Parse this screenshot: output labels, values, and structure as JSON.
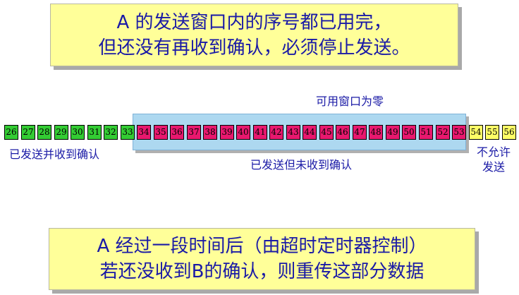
{
  "top_note": {
    "line1": "A 的发送窗口内的序号都已用完，",
    "line2": "但还没有再收到确认，必须停止发送。"
  },
  "bottom_note": {
    "line1": "A 经过一段时间后（由超时定时器控制）",
    "line2": "若还没收到B的确认，则重传这部分数据"
  },
  "labels": {
    "window": "可用窗口为零",
    "acked": "已发送并收到确认",
    "sent_unacked": "已发送但未收到确认",
    "not_allowed_1": "不允许",
    "not_allowed_2": "发送"
  },
  "segments": [
    {
      "state": "acked",
      "seqs": [
        "26",
        "27",
        "28",
        "29",
        "30",
        "31",
        "32",
        "33"
      ]
    },
    {
      "state": "sent",
      "seqs": [
        "34",
        "35",
        "36",
        "37",
        "38",
        "39",
        "40",
        "41",
        "42",
        "43",
        "44",
        "45",
        "46",
        "47",
        "48",
        "49",
        "50",
        "51",
        "52",
        "53"
      ]
    },
    {
      "state": "blocked",
      "seqs": [
        "54",
        "55",
        "56"
      ]
    }
  ],
  "colors": {
    "acked": "#33cc33",
    "sent_unacked": "#e8186e",
    "not_allowed": "#ffff66",
    "window": "#add8f0",
    "note_bg": "#ffff99",
    "text": "#1a1aa6"
  }
}
